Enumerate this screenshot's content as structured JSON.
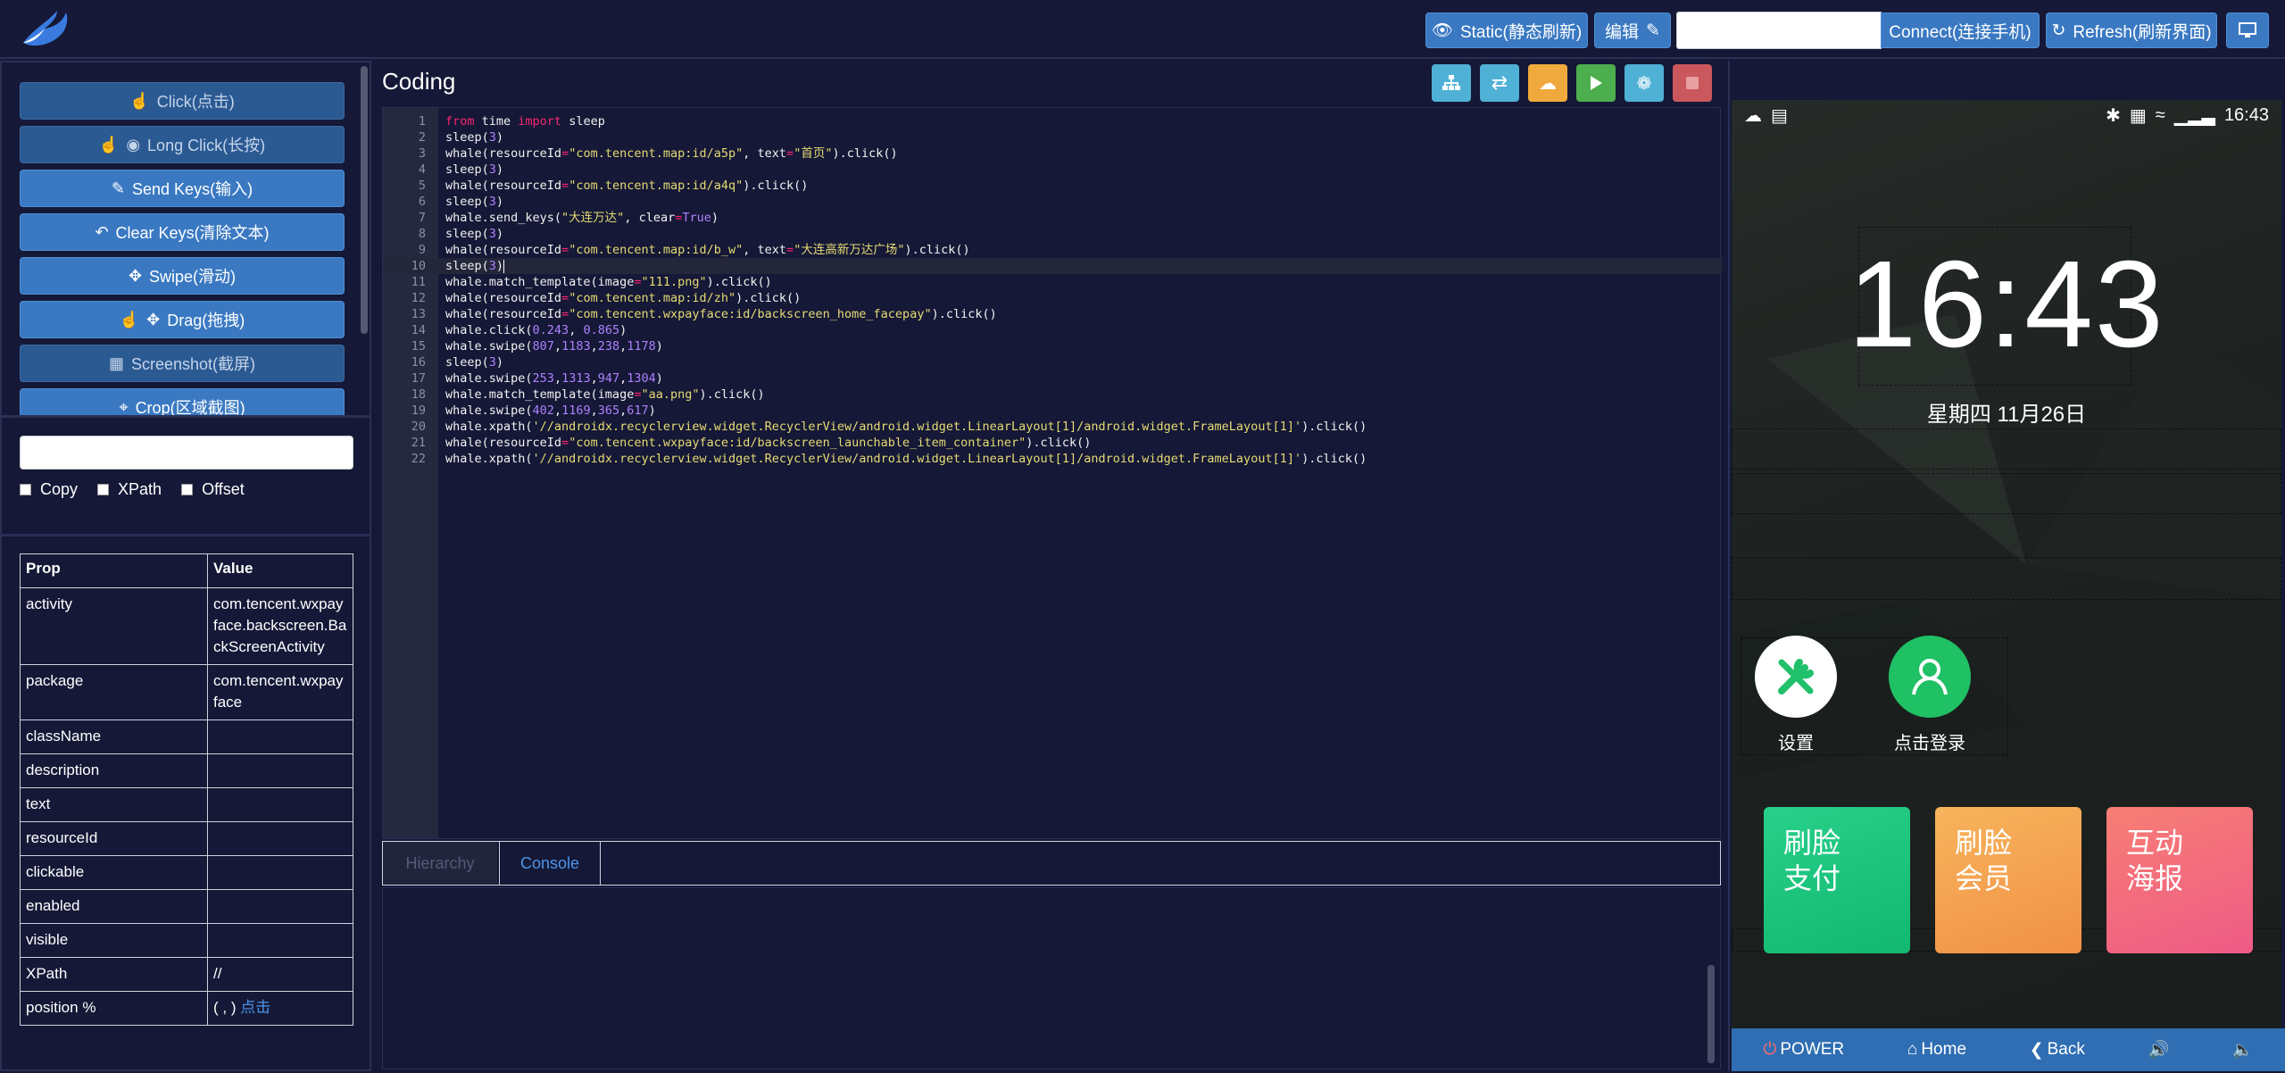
{
  "topbar": {
    "static_label": "Static(静态刷新)",
    "edit_label": "编辑",
    "url_value": "",
    "connect_label": "Connect(连接手机)",
    "refresh_label": "Refresh(刷新界面)"
  },
  "actions": [
    {
      "label": "Click(点击)",
      "icon": "hand-pointer-icon",
      "dim": true
    },
    {
      "label": "Long Click(长按)",
      "icon": "hand-pointer-icon",
      "dim": true
    },
    {
      "label": "Send Keys(输入)",
      "icon": "pencil-icon",
      "dim": false
    },
    {
      "label": "Clear Keys(清除文本)",
      "icon": "reply-icon",
      "dim": false
    },
    {
      "label": "Swipe(滑动)",
      "icon": "arrows-icon",
      "dim": false
    },
    {
      "label": "Drag(拖拽)",
      "icon": "hand-pointer-icon",
      "dim": false
    },
    {
      "label": "Screenshot(截屏)",
      "icon": "grid-icon",
      "dim": true
    },
    {
      "label": "Crop(区域截图)",
      "icon": "crop-icon",
      "dim": false
    }
  ],
  "xpath_input": "",
  "checks": [
    "Copy",
    "XPath",
    "Offset"
  ],
  "props": {
    "headers": [
      "Prop",
      "Value"
    ],
    "rows": [
      {
        "key": "activity",
        "value": "com.tencent.wxpay face.backscreen.Ba ckScreenActivity"
      },
      {
        "key": "package",
        "value": "com.tencent.wxpay face"
      },
      {
        "key": "className",
        "value": ""
      },
      {
        "key": "description",
        "value": ""
      },
      {
        "key": "text",
        "value": ""
      },
      {
        "key": "resourceId",
        "value": ""
      },
      {
        "key": "clickable",
        "value": ""
      },
      {
        "key": "enabled",
        "value": ""
      },
      {
        "key": "visible",
        "value": ""
      },
      {
        "key": "XPath",
        "value": "//"
      },
      {
        "key": "position %",
        "value": "( , )",
        "link": "点击"
      }
    ]
  },
  "coding": {
    "title": "Coding",
    "active_line": 10,
    "lines": [
      "from time import sleep",
      "sleep(3)",
      "whale(resourceId=\"com.tencent.map:id/a5p\", text=\"首页\").click()",
      "sleep(3)",
      "whale(resourceId=\"com.tencent.map:id/a4q\").click()",
      "sleep(3)",
      "whale.send_keys(\"大连万达\", clear=True)",
      "sleep(3)",
      "whale(resourceId=\"com.tencent.map:id/b_w\", text=\"大连高新万达广场\").click()",
      "sleep(3)",
      "whale.match_template(image=\"111.png\").click()",
      "whale(resourceId=\"com.tencent.map:id/zh\").click()",
      "whale(resourceId=\"com.tencent.wxpayface:id/backscreen_home_facepay\").click()",
      "whale.click(0.243, 0.865)",
      "whale.swipe(807,1183,238,1178)",
      "sleep(3)",
      "whale.swipe(253,1313,947,1304)",
      "whale.match_template(image=\"aa.png\").click()",
      "whale.swipe(402,1169,365,617)",
      "whale.xpath('//androidx.recyclerview.widget.RecyclerView/android.widget.LinearLayout[1]/android.widget.FrameLayout[1]').click()",
      "whale(resourceId=\"com.tencent.wxpayface:id/backscreen_launchable_item_container\").click()",
      "whale.xpath('//androidx.recyclerview.widget.RecyclerView/android.widget.LinearLayout[1]/android.widget.FrameLayout[1]').click()"
    ]
  },
  "tabs": {
    "hierarchy": "Hierarchy",
    "console": "Console"
  },
  "phone": {
    "status_time": "16:43",
    "clock": "16:43",
    "date": "星期四 11月26日",
    "apps": [
      {
        "label": "设置",
        "icon": "settings-tools-icon"
      },
      {
        "label": "点击登录",
        "icon": "user-login-icon"
      }
    ],
    "cards": [
      {
        "text": "刷脸\n支付",
        "color": "#1ec77c"
      },
      {
        "text": "刷脸\n会员",
        "color": "#f3a052"
      },
      {
        "text": "互动\n海报",
        "color": "#f26a78"
      }
    ]
  },
  "bottombar": {
    "power": "POWER",
    "home": "Home",
    "back": "Back"
  }
}
